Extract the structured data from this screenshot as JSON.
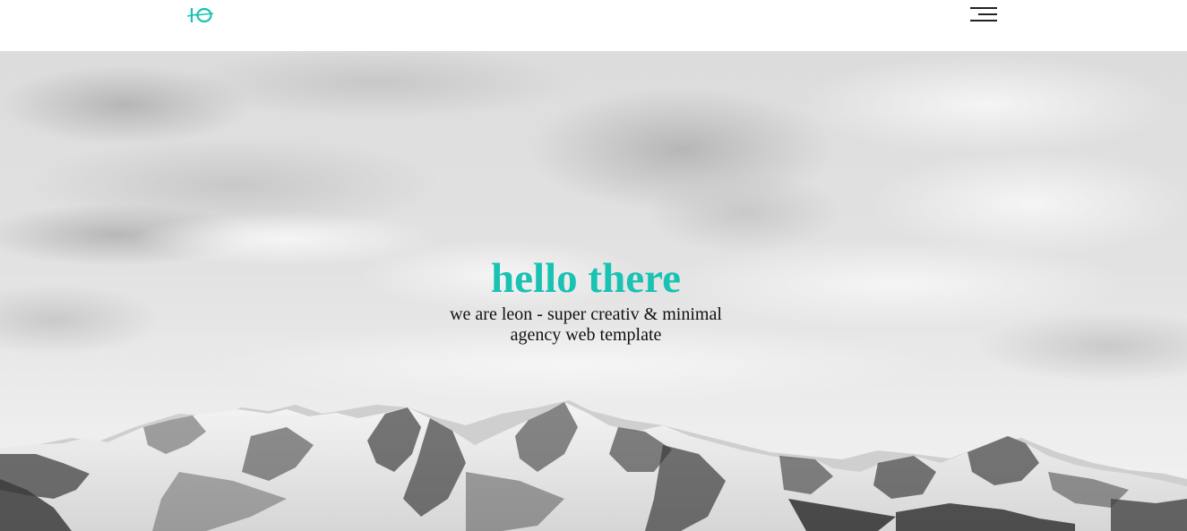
{
  "header": {
    "logo_text": "IO",
    "logo_icon": "leon-monogram-logo",
    "menu_icon": "hamburger-menu-icon"
  },
  "hero": {
    "title": "hello there",
    "subtitle": "we are leon - super creativ & minimal agency web template",
    "background": "black-and-white snowy mountain range under cloudy sky"
  },
  "colors": {
    "accent": "#19c2b3",
    "text": "#111111",
    "header_bg": "#ffffff"
  }
}
